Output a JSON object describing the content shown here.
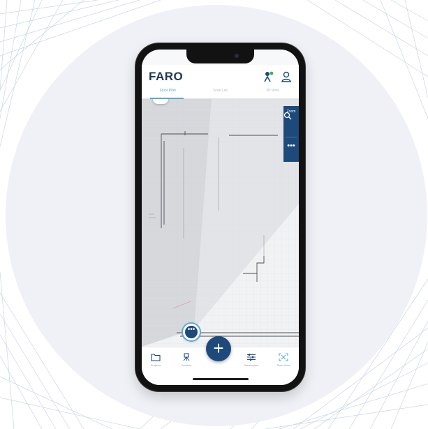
{
  "app": {
    "logo_text": "FARO",
    "brand_color": "#1d4a7a",
    "accent_color": "#5aa8dc"
  },
  "header": {
    "icons": [
      "device-status-icon",
      "user-profile-icon"
    ]
  },
  "tabs": [
    {
      "label": "Floor Plan",
      "active": true
    },
    {
      "label": "Scan List",
      "active": false
    },
    {
      "label": "3D View",
      "active": false
    }
  ],
  "map_controls": {
    "collapse_symbol": "⌃",
    "zoom_label": "Zoom",
    "more_symbol": "•••"
  },
  "scan_point": {
    "symbol": "•••"
  },
  "fab": {
    "symbol": "+"
  },
  "bottom_nav": [
    {
      "label": "Projects",
      "icon": "folder-icon",
      "active": false
    },
    {
      "label": "Devices",
      "icon": "scanner-icon",
      "active": false
    },
    {
      "label": "Parameters",
      "icon": "sliders-icon",
      "active": false
    },
    {
      "label": "Scan View",
      "icon": "scan-frame-icon",
      "active": true
    }
  ]
}
